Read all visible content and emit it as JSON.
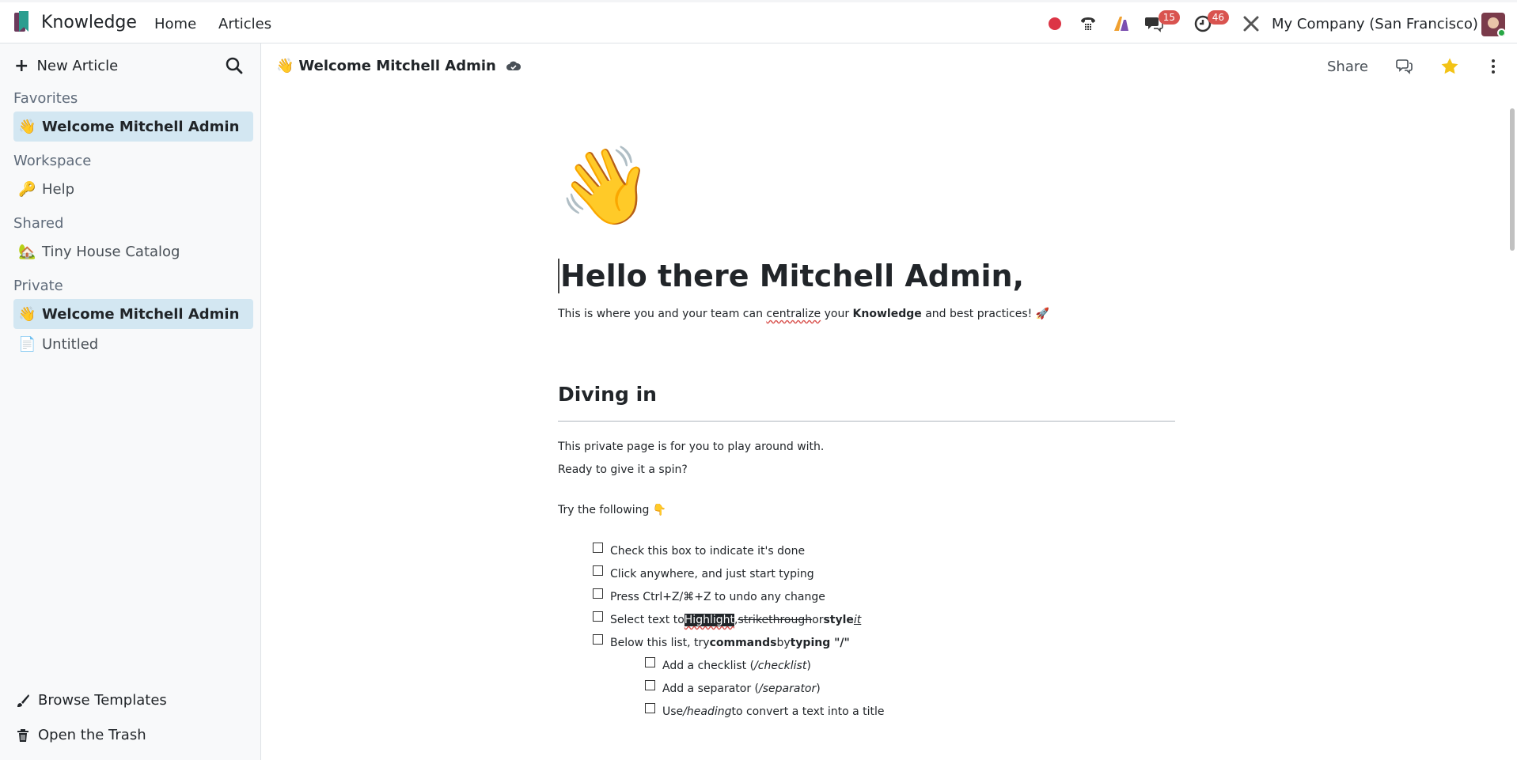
{
  "topbar": {
    "app_name": "Knowledge",
    "menu": [
      "Home",
      "Articles"
    ],
    "messages_count": "15",
    "activities_count": "46",
    "company": "My Company (San Francisco)"
  },
  "sidebar": {
    "new_article": "New Article",
    "sections": {
      "favorites": "Favorites",
      "workspace": "Workspace",
      "shared": "Shared",
      "private": "Private"
    },
    "favorites": [
      {
        "emoji": "👋",
        "label": "Welcome Mitchell Admin"
      }
    ],
    "workspace": [
      {
        "emoji": "🔑",
        "label": "Help"
      }
    ],
    "shared": [
      {
        "emoji": "🏡",
        "label": "Tiny House Catalog"
      }
    ],
    "private": [
      {
        "emoji": "👋",
        "label": "Welcome Mitchell Admin"
      },
      {
        "emoji": "📄",
        "label": "Untitled"
      }
    ],
    "browse_templates": "Browse Templates",
    "open_trash": "Open the Trash"
  },
  "header": {
    "emoji": "👋",
    "title": "Welcome Mitchell Admin",
    "share": "Share"
  },
  "article": {
    "big_emoji": "👋",
    "title": "Hello there Mitchell Admin,",
    "intro_a": "This is where you and your team can ",
    "intro_b": "centralize",
    "intro_c": " your ",
    "intro_d": "Knowledge",
    "intro_e": " and best practices! 🚀",
    "h2": "Diving in",
    "p1": "This private page is for you to play around with.",
    "p2": "Ready to give it a spin?",
    "p3": "Try the following 👇",
    "check1": "Check this box to indicate it's done",
    "check2": "Click anywhere, and just start typing",
    "check3": "Press Ctrl+Z/⌘+Z to undo any change",
    "check4_a": "Select text to ",
    "check4_b": "Highlight",
    "check4_c": ", ",
    "check4_d": "strikethrough",
    "check4_e": " or ",
    "check4_f": "style",
    "check4_g": " ",
    "check4_h": "it",
    "check5_a": "Below this list, try ",
    "check5_b": "commands",
    "check5_c": " by ",
    "check5_d": "typing \"/\"",
    "sub1_a": "Add a checklist (",
    "sub1_b": "/checklist",
    "sub1_c": ")",
    "sub2_a": "Add a separator (",
    "sub2_b": "/separator",
    "sub2_c": ")",
    "sub3_a": "Use ",
    "sub3_b": "/heading",
    "sub3_c": " to convert a text into a title"
  },
  "colors": {
    "accent": "#d3e7f2",
    "badge": "#d9534f",
    "star": "#f3c316",
    "record": "#dc3545"
  }
}
